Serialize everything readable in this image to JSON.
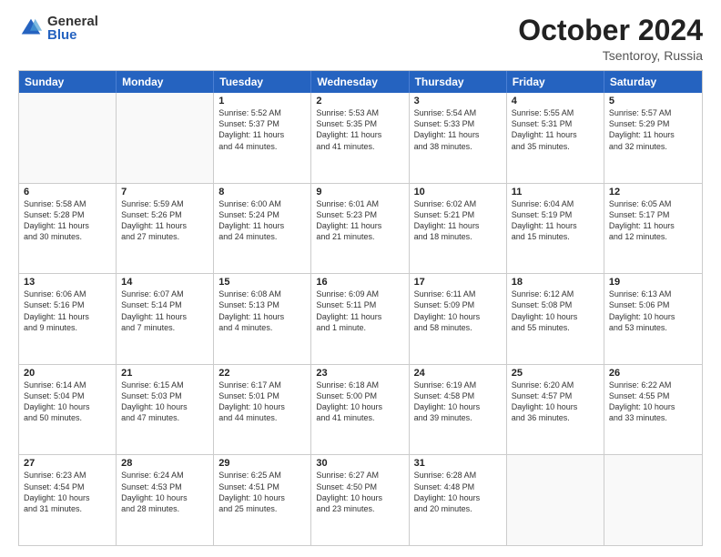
{
  "logo": {
    "general": "General",
    "blue": "Blue"
  },
  "title": "October 2024",
  "location": "Tsentoroy, Russia",
  "days": [
    "Sunday",
    "Monday",
    "Tuesday",
    "Wednesday",
    "Thursday",
    "Friday",
    "Saturday"
  ],
  "rows": [
    [
      {
        "day": "",
        "empty": true
      },
      {
        "day": "",
        "empty": true
      },
      {
        "day": "1",
        "lines": [
          "Sunrise: 5:52 AM",
          "Sunset: 5:37 PM",
          "Daylight: 11 hours",
          "and 44 minutes."
        ]
      },
      {
        "day": "2",
        "lines": [
          "Sunrise: 5:53 AM",
          "Sunset: 5:35 PM",
          "Daylight: 11 hours",
          "and 41 minutes."
        ]
      },
      {
        "day": "3",
        "lines": [
          "Sunrise: 5:54 AM",
          "Sunset: 5:33 PM",
          "Daylight: 11 hours",
          "and 38 minutes."
        ]
      },
      {
        "day": "4",
        "lines": [
          "Sunrise: 5:55 AM",
          "Sunset: 5:31 PM",
          "Daylight: 11 hours",
          "and 35 minutes."
        ]
      },
      {
        "day": "5",
        "lines": [
          "Sunrise: 5:57 AM",
          "Sunset: 5:29 PM",
          "Daylight: 11 hours",
          "and 32 minutes."
        ]
      }
    ],
    [
      {
        "day": "6",
        "lines": [
          "Sunrise: 5:58 AM",
          "Sunset: 5:28 PM",
          "Daylight: 11 hours",
          "and 30 minutes."
        ]
      },
      {
        "day": "7",
        "lines": [
          "Sunrise: 5:59 AM",
          "Sunset: 5:26 PM",
          "Daylight: 11 hours",
          "and 27 minutes."
        ]
      },
      {
        "day": "8",
        "lines": [
          "Sunrise: 6:00 AM",
          "Sunset: 5:24 PM",
          "Daylight: 11 hours",
          "and 24 minutes."
        ]
      },
      {
        "day": "9",
        "lines": [
          "Sunrise: 6:01 AM",
          "Sunset: 5:23 PM",
          "Daylight: 11 hours",
          "and 21 minutes."
        ]
      },
      {
        "day": "10",
        "lines": [
          "Sunrise: 6:02 AM",
          "Sunset: 5:21 PM",
          "Daylight: 11 hours",
          "and 18 minutes."
        ]
      },
      {
        "day": "11",
        "lines": [
          "Sunrise: 6:04 AM",
          "Sunset: 5:19 PM",
          "Daylight: 11 hours",
          "and 15 minutes."
        ]
      },
      {
        "day": "12",
        "lines": [
          "Sunrise: 6:05 AM",
          "Sunset: 5:17 PM",
          "Daylight: 11 hours",
          "and 12 minutes."
        ]
      }
    ],
    [
      {
        "day": "13",
        "lines": [
          "Sunrise: 6:06 AM",
          "Sunset: 5:16 PM",
          "Daylight: 11 hours",
          "and 9 minutes."
        ]
      },
      {
        "day": "14",
        "lines": [
          "Sunrise: 6:07 AM",
          "Sunset: 5:14 PM",
          "Daylight: 11 hours",
          "and 7 minutes."
        ]
      },
      {
        "day": "15",
        "lines": [
          "Sunrise: 6:08 AM",
          "Sunset: 5:13 PM",
          "Daylight: 11 hours",
          "and 4 minutes."
        ]
      },
      {
        "day": "16",
        "lines": [
          "Sunrise: 6:09 AM",
          "Sunset: 5:11 PM",
          "Daylight: 11 hours",
          "and 1 minute."
        ]
      },
      {
        "day": "17",
        "lines": [
          "Sunrise: 6:11 AM",
          "Sunset: 5:09 PM",
          "Daylight: 10 hours",
          "and 58 minutes."
        ]
      },
      {
        "day": "18",
        "lines": [
          "Sunrise: 6:12 AM",
          "Sunset: 5:08 PM",
          "Daylight: 10 hours",
          "and 55 minutes."
        ]
      },
      {
        "day": "19",
        "lines": [
          "Sunrise: 6:13 AM",
          "Sunset: 5:06 PM",
          "Daylight: 10 hours",
          "and 53 minutes."
        ]
      }
    ],
    [
      {
        "day": "20",
        "lines": [
          "Sunrise: 6:14 AM",
          "Sunset: 5:04 PM",
          "Daylight: 10 hours",
          "and 50 minutes."
        ]
      },
      {
        "day": "21",
        "lines": [
          "Sunrise: 6:15 AM",
          "Sunset: 5:03 PM",
          "Daylight: 10 hours",
          "and 47 minutes."
        ]
      },
      {
        "day": "22",
        "lines": [
          "Sunrise: 6:17 AM",
          "Sunset: 5:01 PM",
          "Daylight: 10 hours",
          "and 44 minutes."
        ]
      },
      {
        "day": "23",
        "lines": [
          "Sunrise: 6:18 AM",
          "Sunset: 5:00 PM",
          "Daylight: 10 hours",
          "and 41 minutes."
        ]
      },
      {
        "day": "24",
        "lines": [
          "Sunrise: 6:19 AM",
          "Sunset: 4:58 PM",
          "Daylight: 10 hours",
          "and 39 minutes."
        ]
      },
      {
        "day": "25",
        "lines": [
          "Sunrise: 6:20 AM",
          "Sunset: 4:57 PM",
          "Daylight: 10 hours",
          "and 36 minutes."
        ]
      },
      {
        "day": "26",
        "lines": [
          "Sunrise: 6:22 AM",
          "Sunset: 4:55 PM",
          "Daylight: 10 hours",
          "and 33 minutes."
        ]
      }
    ],
    [
      {
        "day": "27",
        "lines": [
          "Sunrise: 6:23 AM",
          "Sunset: 4:54 PM",
          "Daylight: 10 hours",
          "and 31 minutes."
        ]
      },
      {
        "day": "28",
        "lines": [
          "Sunrise: 6:24 AM",
          "Sunset: 4:53 PM",
          "Daylight: 10 hours",
          "and 28 minutes."
        ]
      },
      {
        "day": "29",
        "lines": [
          "Sunrise: 6:25 AM",
          "Sunset: 4:51 PM",
          "Daylight: 10 hours",
          "and 25 minutes."
        ]
      },
      {
        "day": "30",
        "lines": [
          "Sunrise: 6:27 AM",
          "Sunset: 4:50 PM",
          "Daylight: 10 hours",
          "and 23 minutes."
        ]
      },
      {
        "day": "31",
        "lines": [
          "Sunrise: 6:28 AM",
          "Sunset: 4:48 PM",
          "Daylight: 10 hours",
          "and 20 minutes."
        ]
      },
      {
        "day": "",
        "empty": true
      },
      {
        "day": "",
        "empty": true
      }
    ]
  ]
}
